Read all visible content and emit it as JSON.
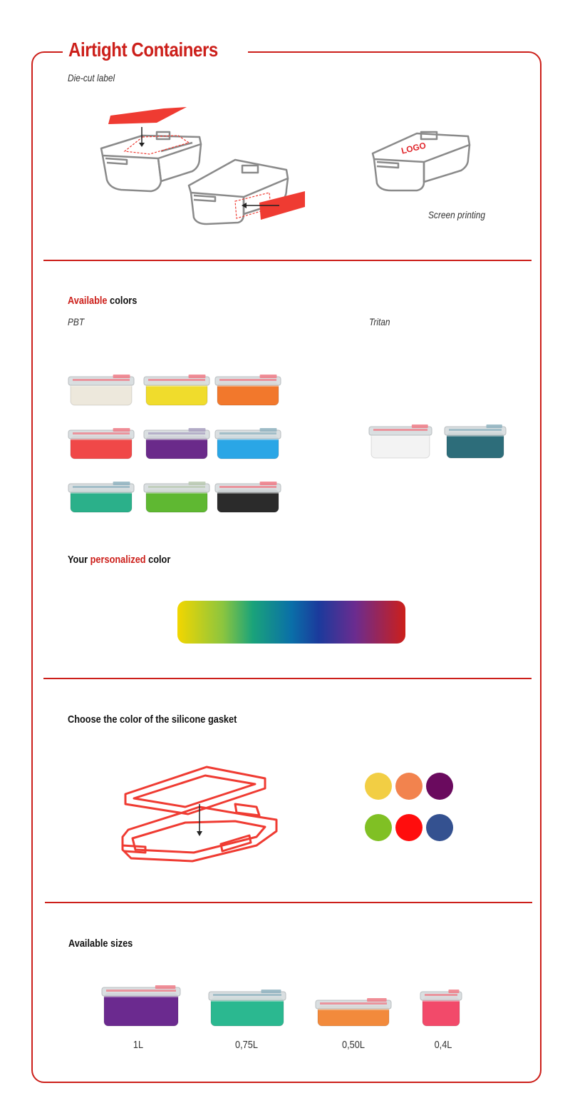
{
  "header": {
    "title": "Airtight Containers"
  },
  "printing": {
    "die_cut_label": "Die-cut label",
    "screen_printing_label": "Screen printing",
    "logo_text": "LOGO"
  },
  "colors_section": {
    "heading_accent": "Available",
    "heading_rest": " colors",
    "pbt_label": "PBT",
    "tritan_label": "Tritan",
    "pbt_colors": [
      "#ede8dc",
      "#f0dc2c",
      "#f2782c",
      "#f04848",
      "#6a2a8a",
      "#2aa6e6",
      "#2bb08a",
      "#5fb832",
      "#2b2b2b"
    ],
    "tritan_colors": [
      "#f3f3f3",
      "#2d6d7a"
    ],
    "personalized_prefix": "Your ",
    "personalized_accent": "personalized",
    "personalized_suffix": " color"
  },
  "gasket_section": {
    "heading": "Choose the color of the silicone gasket",
    "gasket_colors": [
      "#f2ce44",
      "#f2834e",
      "#6a0a5e",
      "#80c024",
      "#ff0d0d",
      "#345190"
    ]
  },
  "sizes_section": {
    "heading": "Available sizes",
    "sizes": [
      {
        "label": "1L",
        "color": "#6b2a8f"
      },
      {
        "label": "0,75L",
        "color": "#2bb890"
      },
      {
        "label": "0,50L",
        "color": "#f28a3c"
      },
      {
        "label": "0,4L",
        "color": "#f24a6a"
      }
    ]
  }
}
